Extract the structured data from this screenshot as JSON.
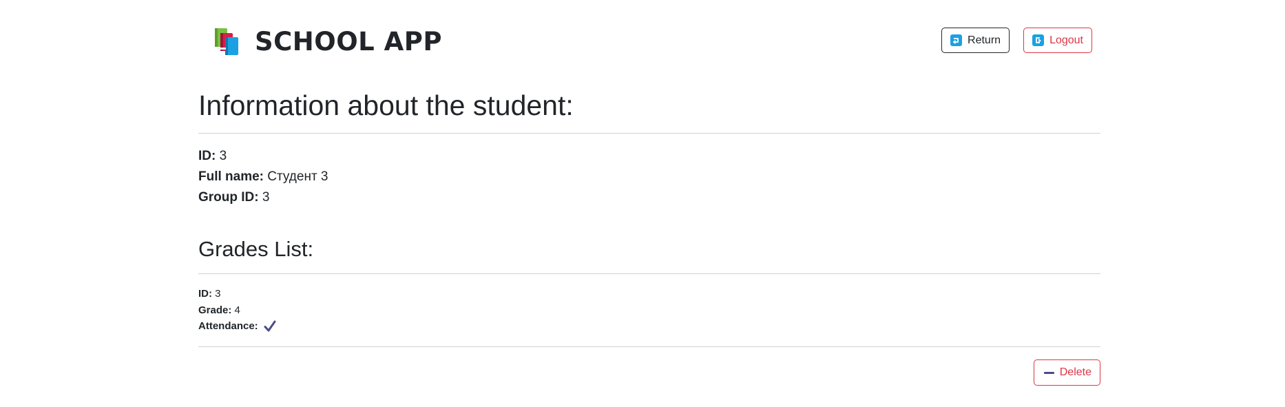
{
  "app": {
    "title": "SCHOOL APP",
    "logo_icon": "books-icon"
  },
  "nav": {
    "return_label": "Return",
    "return_icon": "return-arrow-icon",
    "logout_label": "Logout",
    "logout_icon": "logout-arrow-icon"
  },
  "student": {
    "heading": "Information about the student:",
    "id_label": "ID:",
    "id_value": "3",
    "fullname_label": "Full name:",
    "fullname_value": "Студент 3",
    "group_label": "Group ID:",
    "group_value": "3"
  },
  "grades": {
    "heading": "Grades List:",
    "items": [
      {
        "id_label": "ID:",
        "id_value": "3",
        "grade_label": "Grade:",
        "grade_value": "4",
        "attendance_label": "Attendance:",
        "attendance_icon": "checkmark-icon",
        "attendance": true
      }
    ],
    "delete_label": "Delete",
    "delete_icon": "minus-icon"
  },
  "colors": {
    "danger": "#dc3545",
    "dark": "#212529",
    "icon_blue": "#1ba1e2",
    "check": "#4b4a8a"
  }
}
